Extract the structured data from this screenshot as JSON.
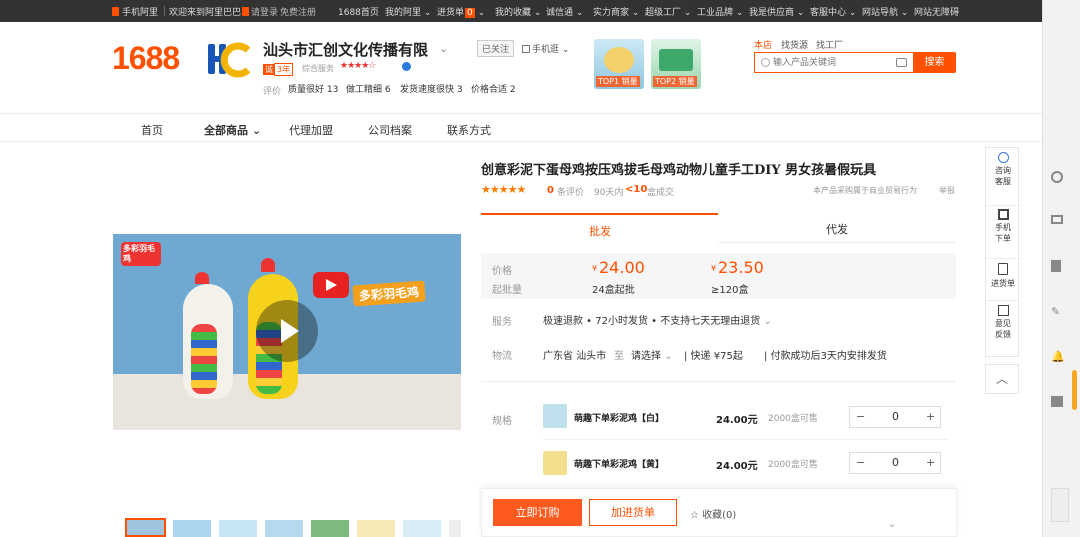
{
  "topbar": {
    "mobile": "手机阿里",
    "welcome": "欢迎来到阿里巴巴",
    "login": "请登录",
    "register": "免费注册",
    "home": "1688首页",
    "my_ali": "我的阿里",
    "cart": "进货单",
    "cart_count": "0",
    "favorites": "我的收藏",
    "credit": "诚信通",
    "factory_strength": "实力商家",
    "super_factory": "超级工厂",
    "industrial": "工业品牌",
    "supplier": "我是供应商",
    "service": "客服中心",
    "site_nav": "网站导航",
    "accessibility": "网站无障碍"
  },
  "header": {
    "logo": "1688",
    "shop_logo": "HC",
    "shop_name": "汕头市汇创文化传播有限",
    "follow": "已关注",
    "mobile_shop": "手机逛",
    "years_badge": "诚",
    "years": "3年",
    "service_label": "综合服务",
    "rating_label": "评价",
    "chips": [
      "质量很好 13",
      "做工精细 6",
      "发货速度很快 3",
      "价格合适 2"
    ],
    "ads": [
      {
        "label": "TOP1 销量"
      },
      {
        "label": "TOP2 销量"
      }
    ],
    "search_tabs": [
      "本店",
      "找货源",
      "找工厂"
    ],
    "search_placeholder": "输入产品关键词",
    "search_button": "搜索"
  },
  "nav": {
    "items": [
      "首页",
      "全部商品",
      "代理加盟",
      "公司档案",
      "联系方式"
    ]
  },
  "product": {
    "title": "创意彩泥下蛋母鸡按压鸡拔毛母鸡动物儿童手工DIY 男女孩暑假玩具",
    "rating_count": "0",
    "rating_text": "条评价",
    "sales_period": "90天内",
    "sales_value": "<10",
    "sales_unit": "盒成交",
    "notice": "本产品采购属于商业贸易行为",
    "report": "举报",
    "video_badge": "多彩羽毛鸡",
    "video_logo": "多彩羽毛鸡",
    "tabs": [
      "批发",
      "代发"
    ],
    "price_label": "价格",
    "moq_label": "起批量",
    "prices": [
      {
        "currency": "¥",
        "value": "24.00",
        "moq": "24盒起批"
      },
      {
        "currency": "¥",
        "value": "23.50",
        "moq": "≥120盒"
      }
    ],
    "service_label": "服务",
    "service_text": "极速退款 • 72小时发货 • 不支持七天无理由退货",
    "logistics_label": "物流",
    "logistics_from": "广东省 汕头市",
    "logistics_to_label": "至",
    "logistics_select": "请选择",
    "express": "快递 ¥75起",
    "ship_note": "付款成功后3天内安排发货",
    "spec_label": "规格",
    "specs": [
      {
        "name": "萌趣下单彩泥鸡【白】",
        "price": "24.00元",
        "stock": "2000盒可售",
        "qty": "0"
      },
      {
        "name": "萌趣下单彩泥鸡【黄】",
        "price": "24.00元",
        "stock": "2000盒可售",
        "qty": "0"
      }
    ],
    "buy_now": "立即订购",
    "add_cart": "加进货单",
    "favorite": "收藏(0)"
  },
  "right_panel": {
    "items": [
      "咨询客服",
      "手机下单",
      "进货单",
      "意见反馈"
    ]
  },
  "colors": {
    "accent": "#ff5000",
    "dark_bar": "#333333"
  }
}
